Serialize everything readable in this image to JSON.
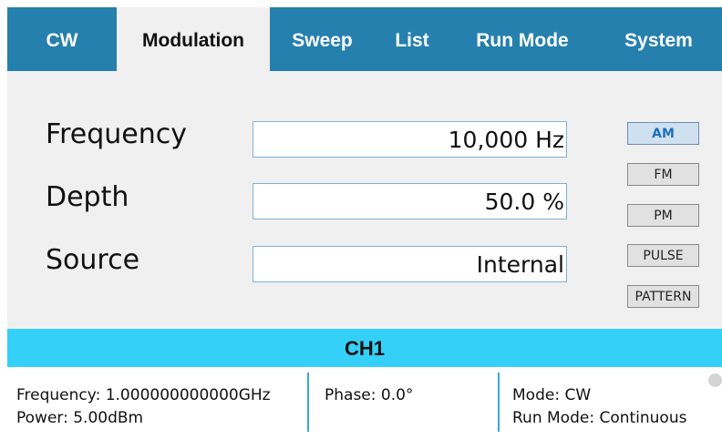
{
  "tabs": [
    {
      "label": "CW",
      "active": false
    },
    {
      "label": "Modulation",
      "active": true
    },
    {
      "label": "Sweep",
      "active": false
    },
    {
      "label": "List",
      "active": false
    },
    {
      "label": "Run Mode",
      "active": false
    },
    {
      "label": "System",
      "active": false
    }
  ],
  "form": {
    "frequency_label": "Frequency",
    "frequency_value": "10,000 Hz",
    "depth_label": "Depth",
    "depth_value": "50.0 %",
    "source_label": "Source",
    "source_value": "Internal"
  },
  "modulation_buttons": [
    {
      "label": "AM",
      "active": true
    },
    {
      "label": "FM",
      "active": false
    },
    {
      "label": "PM",
      "active": false
    },
    {
      "label": "PULSE",
      "active": false
    },
    {
      "label": "PATTERN",
      "active": false
    }
  ],
  "channel": {
    "title": "CH1",
    "frequency": "Frequency: 1.000000000000GHz",
    "power": "Power: 5.00dBm",
    "phase": "Phase: 0.0°",
    "mode": "Mode: CW",
    "run_mode": "Run Mode: Continuous"
  },
  "colors": {
    "tab_bar": "#2680ad",
    "channel_header": "#35d0f7",
    "divider": "#3aa7da",
    "active_mod_text": "#1f6fb8"
  }
}
